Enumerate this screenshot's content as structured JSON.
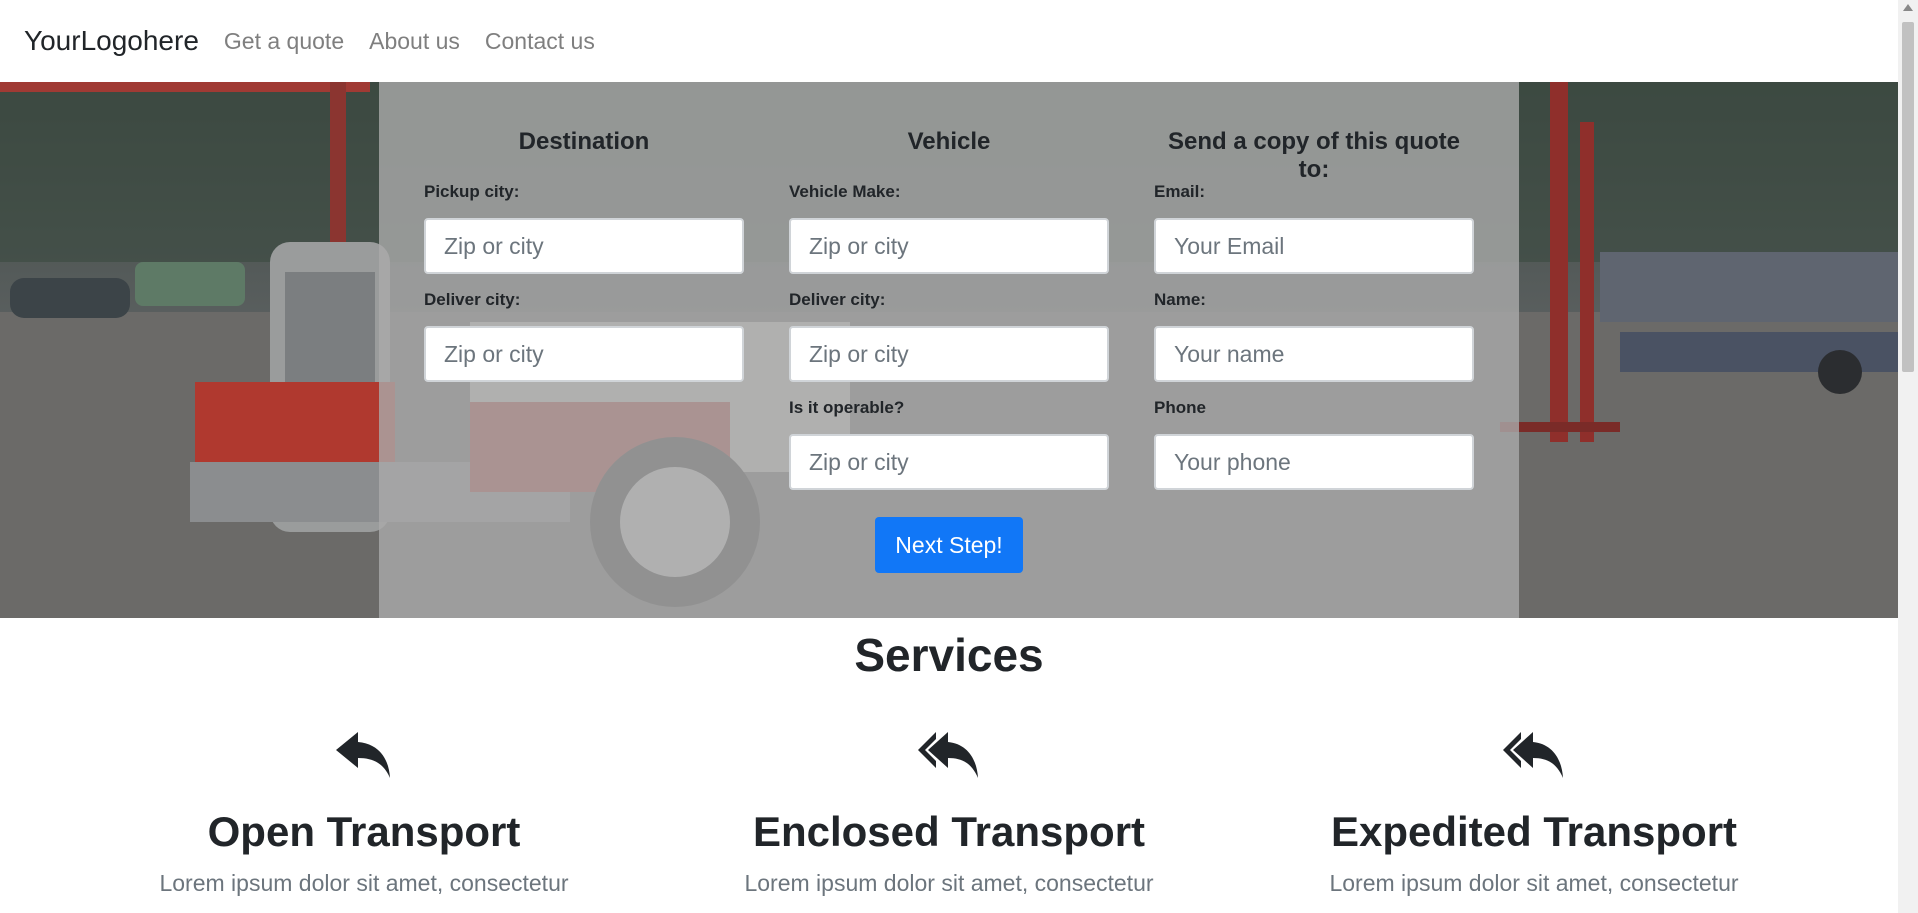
{
  "nav": {
    "brand": "YourLogohere",
    "links": [
      "Get a quote",
      "About us",
      "Contact us"
    ]
  },
  "quote_form": {
    "destination": {
      "heading": "Destination",
      "pickup_label": "Pickup city:",
      "pickup_placeholder": "Zip or city",
      "deliver_label": "Deliver city:",
      "deliver_placeholder": "Zip or city"
    },
    "vehicle": {
      "heading": "Vehicle",
      "make_label": "Vehicle Make:",
      "make_placeholder": "Zip or city",
      "deliver_label": "Deliver city:",
      "deliver_placeholder": "Zip or city",
      "operable_label": "Is it operable?",
      "operable_placeholder": "Zip or city"
    },
    "contact": {
      "heading": "Send a copy of this quote to:",
      "email_label": "Email:",
      "email_placeholder": "Your Email",
      "name_label": "Name:",
      "name_placeholder": "Your name",
      "phone_label": "Phone",
      "phone_placeholder": "Your phone"
    },
    "submit_label": "Next Step!"
  },
  "services": {
    "title": "Services",
    "items": [
      {
        "icon": "reply-icon",
        "title": "Open Transport",
        "text": "Lorem ipsum dolor sit amet, consectetur"
      },
      {
        "icon": "reply-all-icon",
        "title": "Enclosed Transport",
        "text": "Lorem ipsum dolor sit amet, consectetur"
      },
      {
        "icon": "reply-all-icon",
        "title": "Expedited Transport",
        "text": "Lorem ipsum dolor sit amet, consectetur"
      }
    ]
  },
  "colors": {
    "primary_button": "#1177f7",
    "nav_link": "#7f7f7f",
    "text": "#212529",
    "muted_text": "#6c757d"
  }
}
